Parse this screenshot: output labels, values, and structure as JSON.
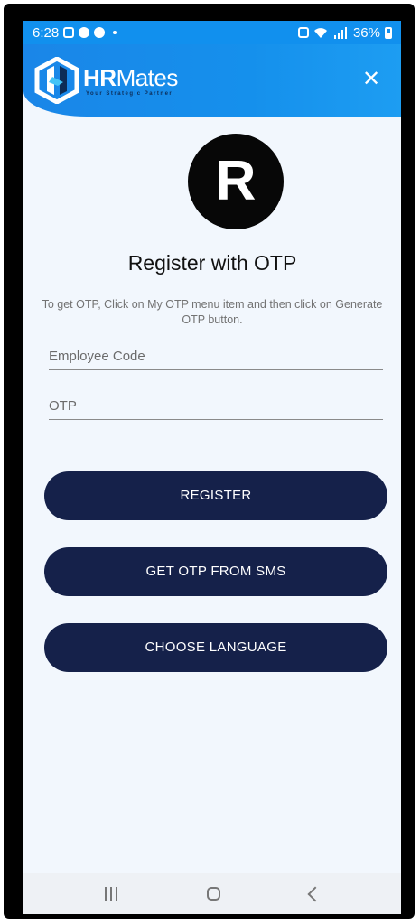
{
  "status_bar": {
    "time": "6:28",
    "battery": "36%",
    "icons": [
      "notification-icon",
      "app-icon",
      "app-icon",
      "alarm-icon",
      "wifi-icon",
      "signal-icon",
      "battery-icon"
    ]
  },
  "header": {
    "logo_brand_hr": "HR",
    "logo_brand_mates": "Mates",
    "logo_tagline": "Your Strategic Partner",
    "close_label": "✕"
  },
  "avatar": {
    "initial": "R"
  },
  "main": {
    "title": "Register with OTP",
    "instructions": "To get OTP, Click on My OTP menu item and then click on Generate OTP button.",
    "employee_code_placeholder": "Employee Code",
    "otp_placeholder": "OTP"
  },
  "buttons": {
    "register": "REGISTER",
    "get_otp_sms": "GET OTP FROM SMS",
    "choose_language": "CHOOSE LANGUAGE"
  },
  "colors": {
    "header": "#1590ec",
    "button": "#15214a",
    "background": "#f2f7fd"
  }
}
